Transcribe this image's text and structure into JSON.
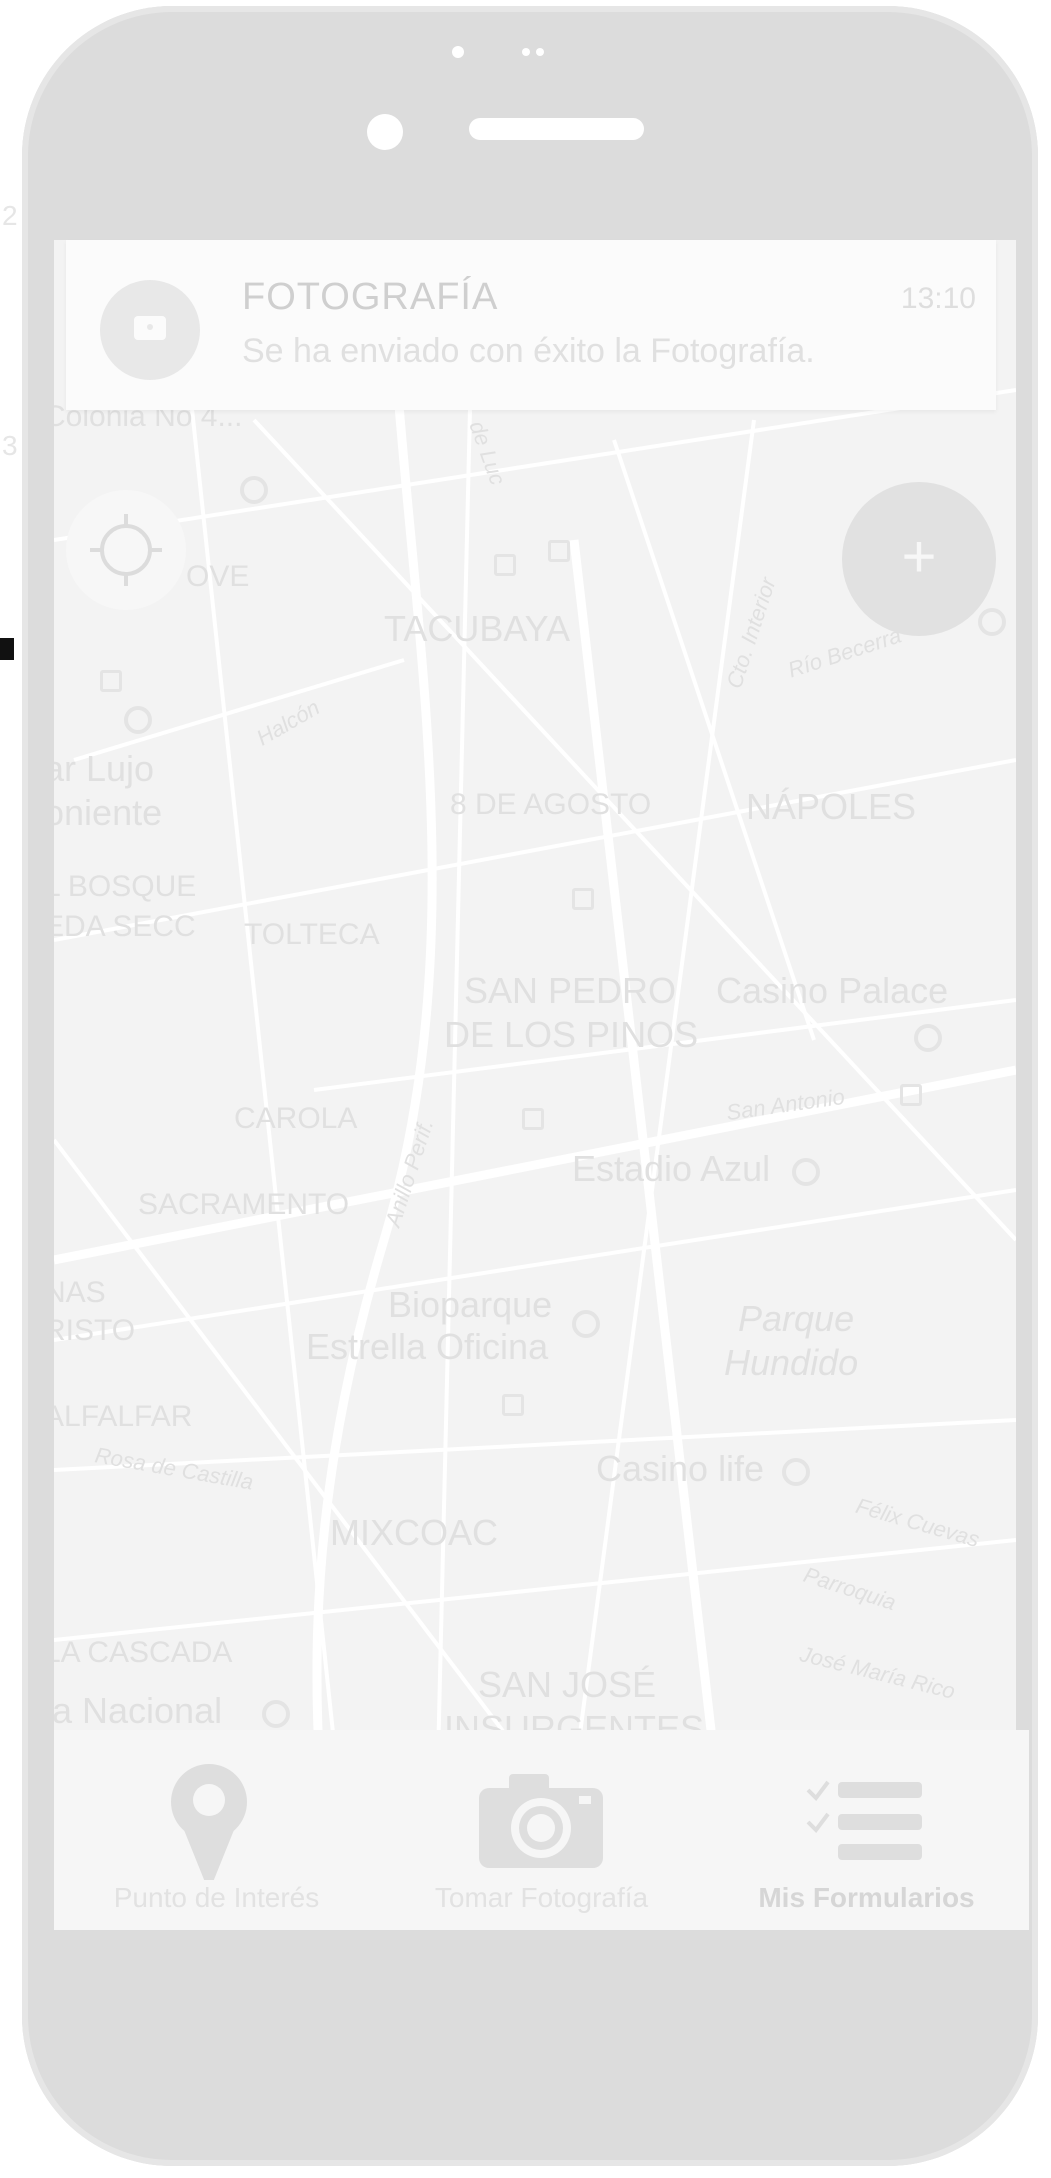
{
  "notification": {
    "title": "FOTOGRAFÍA",
    "time": "13:10",
    "message": "Se ha enviado con éxito la Fotografía."
  },
  "map": {
    "labels": {
      "colonia_no4": "Colonia No 4...",
      "ove": "OVE",
      "tacubaya": "TACUBAYA",
      "calle_de_lucas": "de Luc",
      "av_mexico": "Cto. Interior",
      "rio_becerra": "Río Becerra",
      "halcon": "Halcón",
      "lujo": "ar Lujo",
      "oniente": "oniente",
      "agosto": "8 DE AGOSTO",
      "napoles": "NÁPOLES",
      "bosque": "L BOSQUE",
      "secc": "EDA SECC",
      "tolteca": "TOLTECA",
      "san_pedro_1": "SAN PEDRO",
      "san_pedro_2": "DE LOS PINOS",
      "casino_palace": "Casino Palace",
      "san_antonio": "San Antonio",
      "carola": "CAROLA",
      "anillo": "Anillo Perif.",
      "estadio": "Estadio Azul",
      "sacramento": "SACRAMENTO",
      "nas": "NAS",
      "risto": "RISTO",
      "bioparque_1": "Bioparque",
      "bioparque_2": "Estrella Oficina",
      "parque_1": "Parque",
      "parque_2": "Hundido",
      "alfalfar": "ALFALFAR",
      "rosa": "Rosa de Castilla",
      "casino_life": "Casino life",
      "mixcoac": "MIXCOAC",
      "felix": "Félix Cuevas",
      "parroquia": "Parroquia",
      "cascada": "LA CASCADA",
      "jose_maria": "José María Rico",
      "san_jose_1": "SAN JOSÉ",
      "san_jose_2": "INSURGENTES",
      "nacional": "la Nacional"
    }
  },
  "edge": {
    "digit_top": "2",
    "digit_mid": "3"
  },
  "bottom_nav": {
    "items": [
      {
        "label": "Punto de Interés",
        "icon": "map-pin-icon"
      },
      {
        "label": "Tomar Fotografía",
        "icon": "camera-icon"
      },
      {
        "label": "Mis Formularios",
        "icon": "checklist-icon"
      }
    ]
  },
  "colors": {
    "phone_body": "#dcdcdc",
    "screen_bg": "#f3f3f3",
    "road": "#ffffff"
  }
}
